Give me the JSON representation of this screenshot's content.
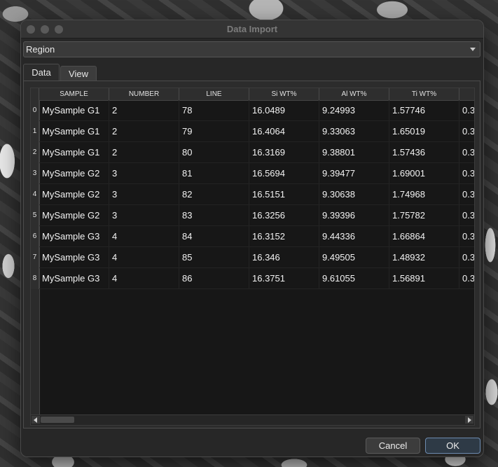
{
  "window": {
    "title": "Data Import"
  },
  "combo": {
    "value": "Region"
  },
  "tabs": [
    {
      "label": "Data"
    },
    {
      "label": "View"
    }
  ],
  "table": {
    "columns": [
      "SAMPLE",
      "NUMBER",
      "LINE",
      "Si WT%",
      "Al WT%",
      "Ti WT%"
    ],
    "rows": [
      {
        "index": "0",
        "cells": [
          "MySample G1",
          "2",
          "78",
          "16.0489",
          "9.24993",
          "1.57746",
          "0.3"
        ]
      },
      {
        "index": "1",
        "cells": [
          "MySample G1",
          "2",
          "79",
          "16.4064",
          "9.33063",
          "1.65019",
          "0.3"
        ]
      },
      {
        "index": "2",
        "cells": [
          "MySample G1",
          "2",
          "80",
          "16.3169",
          "9.38801",
          "1.57436",
          "0.3"
        ]
      },
      {
        "index": "3",
        "cells": [
          "MySample G2",
          "3",
          "81",
          "16.5694",
          "9.39477",
          "1.69001",
          "0.3"
        ]
      },
      {
        "index": "4",
        "cells": [
          "MySample G2",
          "3",
          "82",
          "16.5151",
          "9.30638",
          "1.74968",
          "0.3"
        ]
      },
      {
        "index": "5",
        "cells": [
          "MySample G2",
          "3",
          "83",
          "16.3256",
          "9.39396",
          "1.75782",
          "0.3"
        ]
      },
      {
        "index": "6",
        "cells": [
          "MySample G3",
          "4",
          "84",
          "16.3152",
          "9.44336",
          "1.66864",
          "0.3"
        ]
      },
      {
        "index": "7",
        "cells": [
          "MySample G3",
          "4",
          "85",
          "16.346",
          "9.49505",
          "1.48932",
          "0.3"
        ]
      },
      {
        "index": "8",
        "cells": [
          "MySample G3",
          "4",
          "86",
          "16.3751",
          "9.61055",
          "1.56891",
          "0.3"
        ]
      }
    ]
  },
  "buttons": {
    "cancel": "Cancel",
    "ok": "OK"
  }
}
